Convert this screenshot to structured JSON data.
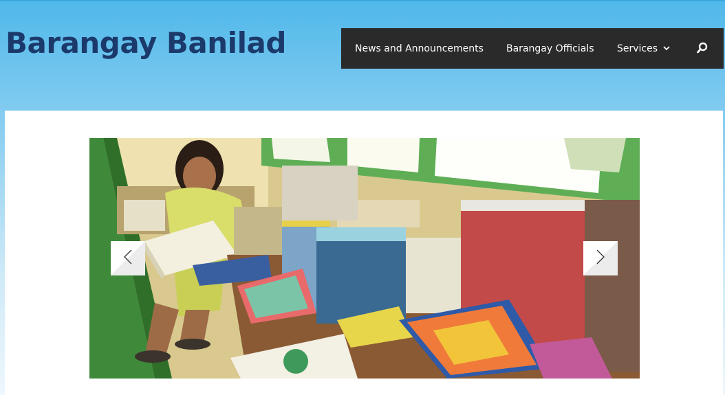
{
  "site": {
    "title": "Barangay Banilad"
  },
  "nav": {
    "items": [
      {
        "label": "News and Announcements"
      },
      {
        "label": "Barangay Officials"
      },
      {
        "label": "Services"
      }
    ],
    "search_icon": "search-icon",
    "dropdown_icon": "chevron-down-icon"
  },
  "slider": {
    "image_description_icon": "photo",
    "prev_icon": "chevron-left-icon",
    "next_icon": "chevron-right-icon"
  },
  "colors": {
    "title": "#1b3a6b",
    "nav_bg": "#2a2a2a",
    "header_gradient_top": "#4fb8ea",
    "header_gradient_bottom": "#eef7fc"
  }
}
